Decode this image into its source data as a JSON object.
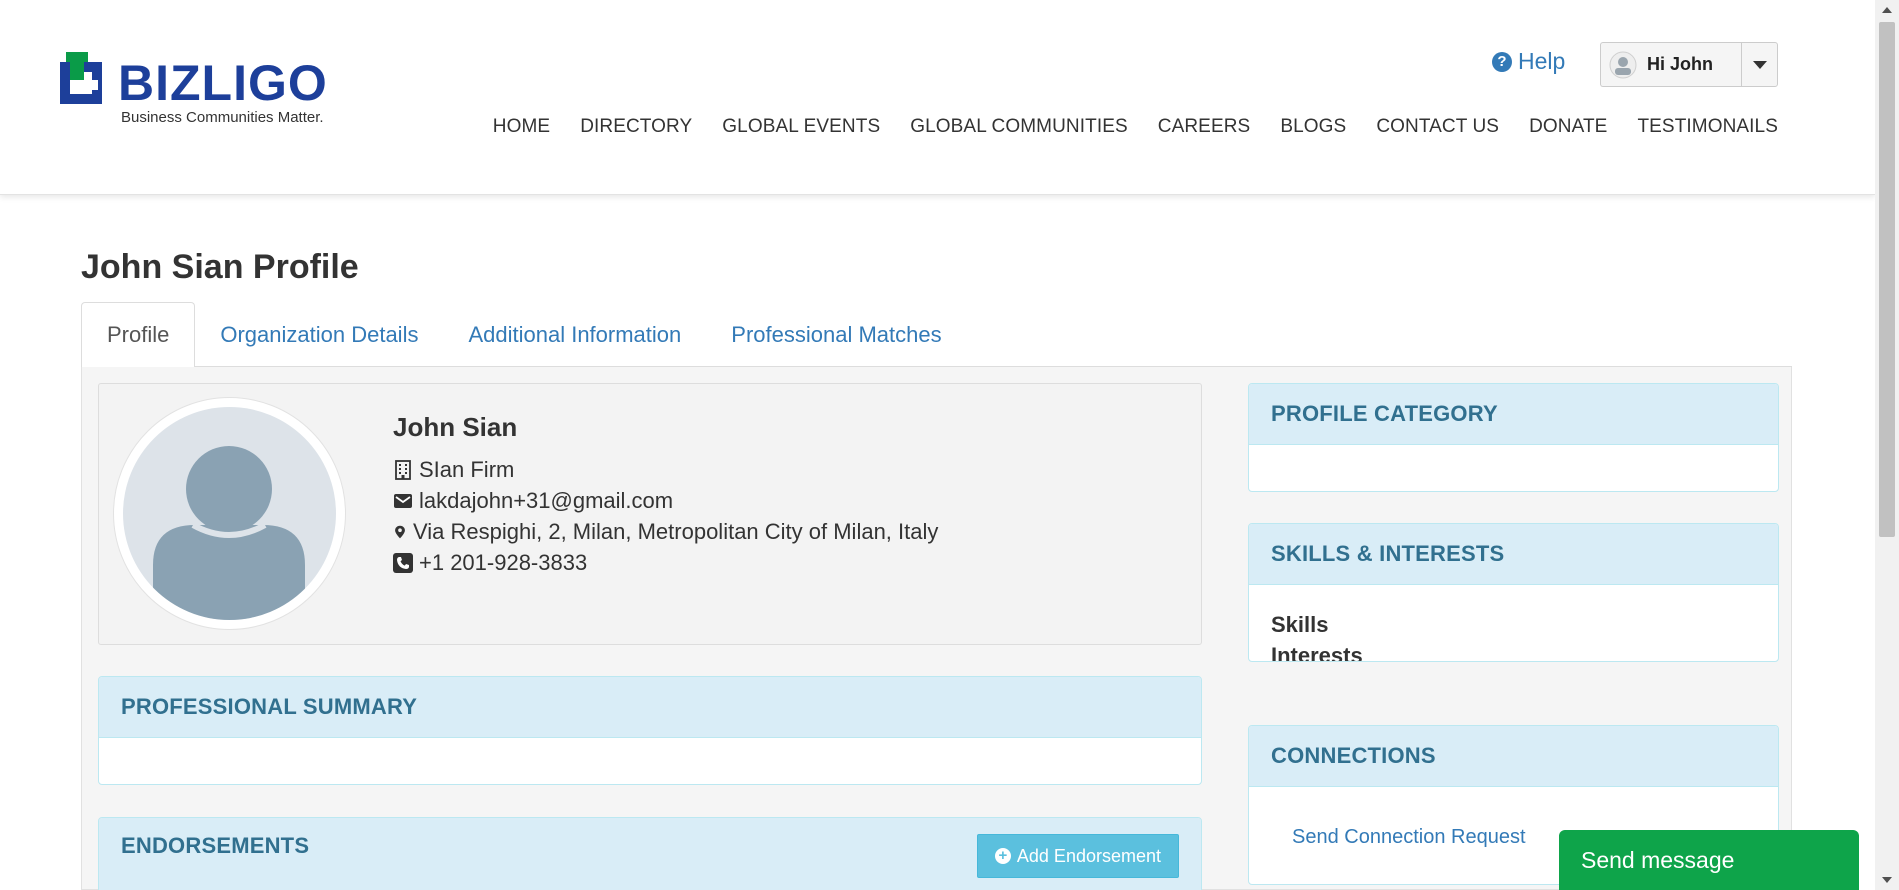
{
  "brand": {
    "name": "BIZLIGO",
    "tagline": "Business Communities Matter.",
    "colors": {
      "primary": "#1d3f9a",
      "mark_green": "#0a9b48"
    }
  },
  "header": {
    "help_label": "Help",
    "user_greeting": "Hi John",
    "nav": [
      "HOME",
      "DIRECTORY",
      "GLOBAL EVENTS",
      "GLOBAL COMMUNITIES",
      "CAREERS",
      "BLOGS",
      "CONTACT US",
      "DONATE",
      "TESTIMONAILS"
    ]
  },
  "page": {
    "title": "John Sian Profile",
    "tabs": [
      {
        "label": "Profile",
        "active": true
      },
      {
        "label": "Organization Details",
        "active": false
      },
      {
        "label": "Additional Information",
        "active": false
      },
      {
        "label": "Professional Matches",
        "active": false
      }
    ]
  },
  "profile": {
    "name": "John Sian",
    "company": "SIan Firm",
    "email": "lakdajohn+31@gmail.com",
    "address": "Via Respighi, 2, Milan, Metropolitan City of Milan, Italy",
    "phone": "+1 201-928-3833",
    "icons": {
      "company": "building-icon",
      "email": "envelope-icon",
      "address": "map-marker-icon",
      "phone": "phone-icon"
    }
  },
  "panels": {
    "professional_summary": {
      "title": "PROFESSIONAL SUMMARY"
    },
    "endorsements": {
      "title": "ENDORSEMENTS",
      "add_button": "Add Endorsement"
    },
    "profile_category": {
      "title": "PROFILE CATEGORY"
    },
    "skills_interests": {
      "title": "SKILLS & INTERESTS",
      "skills_label": "Skills",
      "interests_label": "Interests"
    },
    "connections": {
      "title": "CONNECTIONS",
      "send_request": "Send Connection Request"
    }
  },
  "chat": {
    "send_message": "Send message",
    "color": "#0ea44a"
  }
}
